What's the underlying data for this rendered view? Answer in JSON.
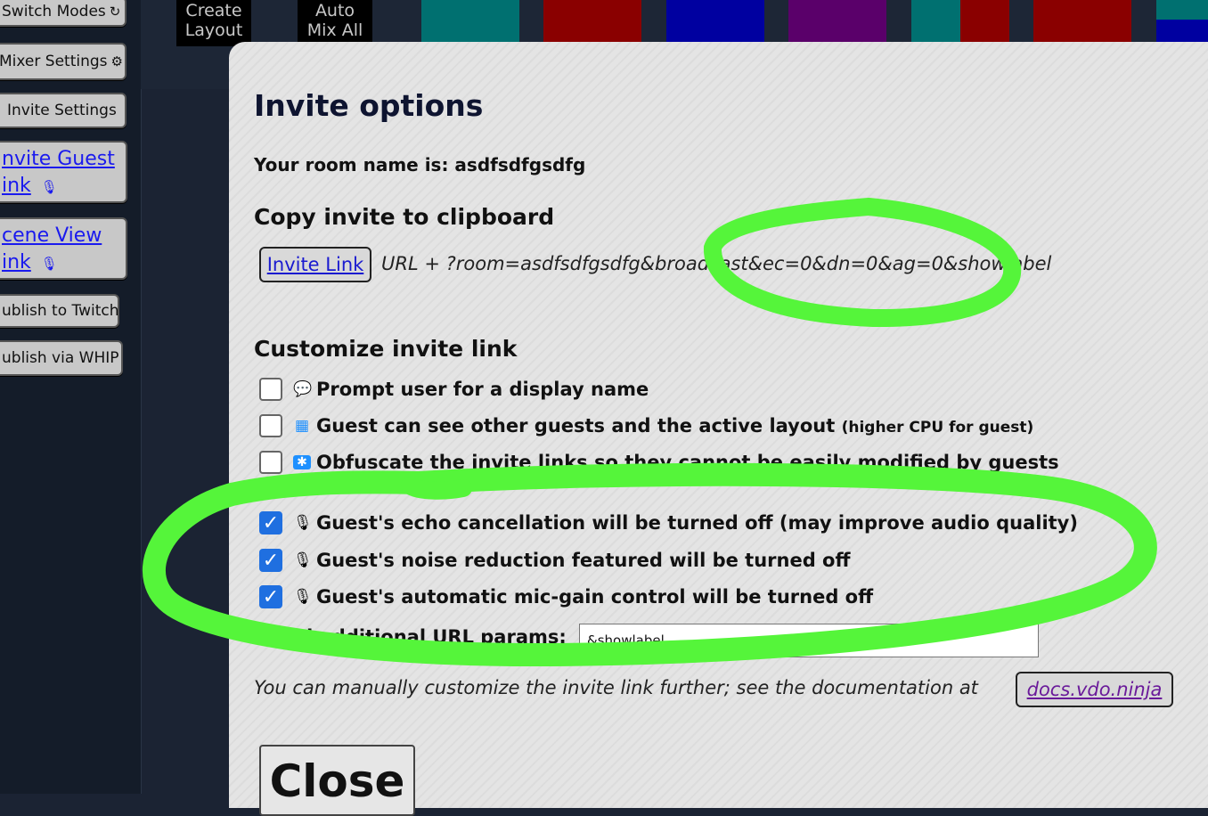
{
  "sidebar": {
    "items": [
      {
        "label": "Switch Modes",
        "glyph": "↻"
      },
      {
        "label": "Mixer Settings",
        "glyph": "⚙"
      },
      {
        "label": "Invite Settings",
        "glyph": ""
      },
      {
        "label_line1": "nvite Guest",
        "label_line2": "ink",
        "glyph": "🎙"
      },
      {
        "label_line1": "cene View",
        "label_line2": "ink",
        "glyph": "🎙"
      },
      {
        "label": "ublish to Twitch",
        "glyph": ""
      },
      {
        "label": "ublish via WHIP",
        "glyph": ""
      }
    ]
  },
  "topbar": {
    "create_line1": "Create",
    "create_line2": "Layout",
    "auto_line1": "Auto",
    "auto_line2": "Mix All",
    "tile_colors": [
      "#007070",
      "#8a0000",
      "#0000a0",
      "#5a006a",
      "#007070",
      "#8a0000",
      "#8a0000",
      "#007070"
    ]
  },
  "modal": {
    "title": "Invite options",
    "room_line": "Your room name is: asdfsdfgsdfg",
    "copy_heading": "Copy invite to clipboard",
    "invite_link_label": "Invite Link",
    "invite_url": "URL + ?room=asdfsdfgsdfg&broadcast&ec=0&dn=0&ag=0&showlabel",
    "customize_heading": "Customize invite link",
    "options": [
      {
        "label": "Prompt user for a display name",
        "note": "",
        "checked": false,
        "icon": "speech-bubble-icon",
        "glyph": "💬"
      },
      {
        "label": "Guest can see other guests and the active layout",
        "note": "(higher CPU for guest)",
        "checked": false,
        "icon": "windows-grid-icon",
        "glyph": "▦"
      },
      {
        "label": "Obfuscate the invite links so they cannot be easily modified by guests",
        "note": "",
        "checked": false,
        "icon": "asterisk-icon",
        "glyph": "✱"
      },
      {
        "label": "Guest's echo cancellation will be turned off (may improve audio quality)",
        "note": "",
        "checked": true,
        "icon": "microphone-icon",
        "glyph": "🎙"
      },
      {
        "label": "Guest's noise reduction featured will be turned off",
        "note": "",
        "checked": true,
        "icon": "microphone-icon",
        "glyph": "🎙"
      },
      {
        "label": "Guest's automatic mic-gain control will be turned off",
        "note": "",
        "checked": true,
        "icon": "microphone-icon",
        "glyph": "🎙"
      }
    ],
    "params_label": "Add additional URL params:",
    "params_value": "&showlabel",
    "doc_note": "You can manually customize the invite link further; see the documentation at",
    "docs_link": "docs.vdo.ninja",
    "close_label": "Close"
  },
  "colors": {
    "annotation": "#55f53a",
    "accent": "#1f6fe0"
  }
}
